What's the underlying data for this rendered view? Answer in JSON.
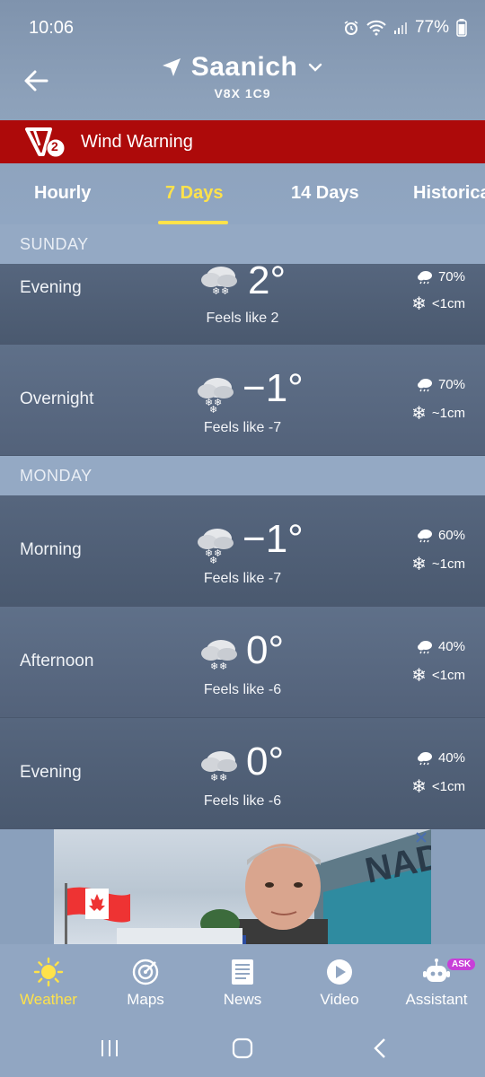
{
  "status": {
    "time": "10:06",
    "battery": "77%"
  },
  "header": {
    "location": "Saanich",
    "postal_code": "V8X 1C9"
  },
  "warning": {
    "level": "2",
    "text": "Wind Warning",
    "color": "#ad0a0a"
  },
  "tabs": [
    {
      "label": "Hourly",
      "active": false
    },
    {
      "label": "7 Days",
      "active": true
    },
    {
      "label": "14 Days",
      "active": false
    },
    {
      "label": "Historica",
      "active": false
    }
  ],
  "days": [
    {
      "name": "SUNDAY",
      "periods": [
        {
          "period": "Evening",
          "temp": "2°",
          "feels": "Feels like 2",
          "pop": "70%",
          "snow": "<1cm"
        },
        {
          "period": "Overnight",
          "temp": "−1°",
          "feels": "Feels like -7",
          "pop": "70%",
          "snow": "~1cm"
        }
      ]
    },
    {
      "name": "MONDAY",
      "periods": [
        {
          "period": "Morning",
          "temp": "−1°",
          "feels": "Feels like -7",
          "pop": "60%",
          "snow": "~1cm"
        },
        {
          "period": "Afternoon",
          "temp": "0°",
          "feels": "Feels like -6",
          "pop": "40%",
          "snow": "<1cm"
        },
        {
          "period": "Evening",
          "temp": "0°",
          "feels": "Feels like -6",
          "pop": "40%",
          "snow": "<1cm"
        }
      ]
    }
  ],
  "ad": {
    "sign_text": "NADA"
  },
  "bottom_nav": [
    {
      "label": "Weather",
      "icon": "sun-icon",
      "active": true
    },
    {
      "label": "Maps",
      "icon": "radar-icon",
      "active": false
    },
    {
      "label": "News",
      "icon": "newspaper-icon",
      "active": false
    },
    {
      "label": "Video",
      "icon": "play-icon",
      "active": false
    },
    {
      "label": "Assistant",
      "icon": "robot-icon",
      "active": false,
      "badge": "ASK"
    }
  ],
  "accent_color": "#ffe24a"
}
